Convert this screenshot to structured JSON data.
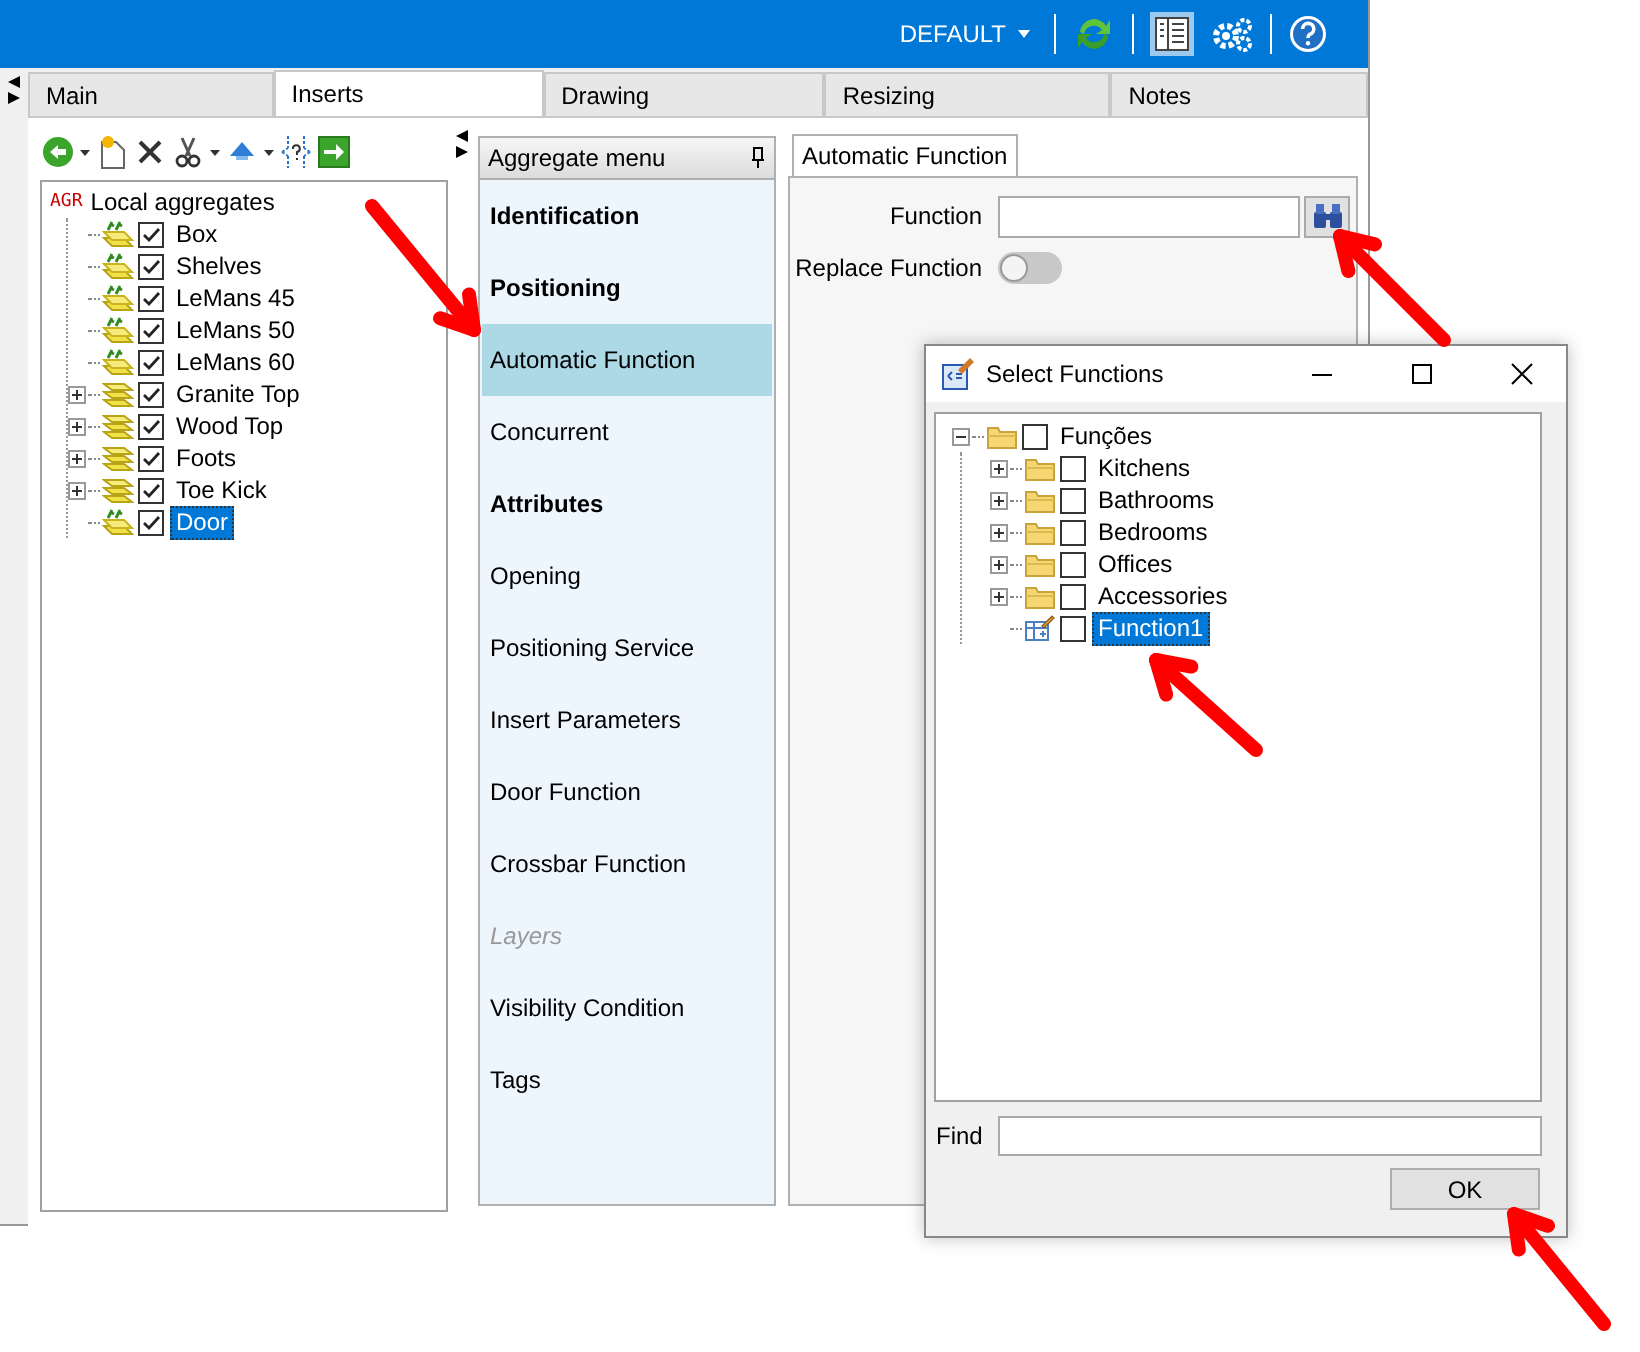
{
  "topbar": {
    "profile": "DEFAULT"
  },
  "tabs": [
    {
      "label": "Main",
      "selected": false
    },
    {
      "label": "Inserts",
      "selected": true
    },
    {
      "label": "Drawing",
      "selected": false
    },
    {
      "label": "Resizing",
      "selected": false
    },
    {
      "label": "Notes",
      "selected": false
    }
  ],
  "aggregates_tree": {
    "root": {
      "badge": "AGR",
      "label": "Local aggregates",
      "children": [
        {
          "label": "Box",
          "kind": "leaf",
          "checked": true,
          "selected": false
        },
        {
          "label": "Shelves",
          "kind": "leaf",
          "checked": true,
          "selected": false
        },
        {
          "label": "LeMans 45",
          "kind": "leaf",
          "checked": true,
          "selected": false
        },
        {
          "label": "LeMans 50",
          "kind": "leaf",
          "checked": true,
          "selected": false
        },
        {
          "label": "LeMans 60",
          "kind": "leaf",
          "checked": true,
          "selected": false
        },
        {
          "label": "Granite Top",
          "kind": "group",
          "checked": true,
          "selected": false
        },
        {
          "label": "Wood Top",
          "kind": "group",
          "checked": true,
          "selected": false
        },
        {
          "label": "Foots",
          "kind": "group",
          "checked": true,
          "selected": false
        },
        {
          "label": "Toe Kick",
          "kind": "group",
          "checked": true,
          "selected": false
        },
        {
          "label": "Door",
          "kind": "leaf",
          "checked": true,
          "selected": true
        }
      ]
    }
  },
  "aggregate_menu": {
    "title": "Aggregate menu",
    "items": [
      {
        "label": "Identification",
        "kind": "heading",
        "selected": false,
        "disabled": false
      },
      {
        "label": "Positioning",
        "kind": "heading",
        "selected": false,
        "disabled": false
      },
      {
        "label": "Automatic Function",
        "kind": "item",
        "selected": true,
        "disabled": false
      },
      {
        "label": "Concurrent",
        "kind": "item",
        "selected": false,
        "disabled": false
      },
      {
        "label": "Attributes",
        "kind": "heading",
        "selected": false,
        "disabled": false
      },
      {
        "label": "Opening",
        "kind": "item",
        "selected": false,
        "disabled": false
      },
      {
        "label": "Positioning Service",
        "kind": "item",
        "selected": false,
        "disabled": false
      },
      {
        "label": "Insert Parameters",
        "kind": "item",
        "selected": false,
        "disabled": false
      },
      {
        "label": "Door Function",
        "kind": "item",
        "selected": false,
        "disabled": false
      },
      {
        "label": "Crossbar Function",
        "kind": "item",
        "selected": false,
        "disabled": false
      },
      {
        "label": "Layers",
        "kind": "item",
        "selected": false,
        "disabled": true
      },
      {
        "label": "Visibility Condition",
        "kind": "item",
        "selected": false,
        "disabled": false
      },
      {
        "label": "Tags",
        "kind": "item",
        "selected": false,
        "disabled": false
      }
    ]
  },
  "detail": {
    "tab": "Automatic Function",
    "function_label": "Function",
    "replace_label": "Replace Function",
    "replace_on": false
  },
  "dialog": {
    "title": "Select Functions",
    "tree": {
      "label": "Funções",
      "kind": "folder",
      "expanded": true,
      "checked": false,
      "selected": false,
      "children": [
        {
          "label": "Kitchens",
          "kind": "folder",
          "expanded": false,
          "checked": false,
          "selected": false
        },
        {
          "label": "Bathrooms",
          "kind": "folder",
          "expanded": false,
          "checked": false,
          "selected": false
        },
        {
          "label": "Bedrooms",
          "kind": "folder",
          "expanded": false,
          "checked": false,
          "selected": false
        },
        {
          "label": "Offices",
          "kind": "folder",
          "expanded": false,
          "checked": false,
          "selected": false
        },
        {
          "label": "Accessories",
          "kind": "folder",
          "expanded": false,
          "checked": false,
          "selected": false
        },
        {
          "label": "Function1",
          "kind": "function",
          "checked": false,
          "selected": true
        }
      ]
    },
    "find_label": "Find",
    "ok": "OK"
  }
}
